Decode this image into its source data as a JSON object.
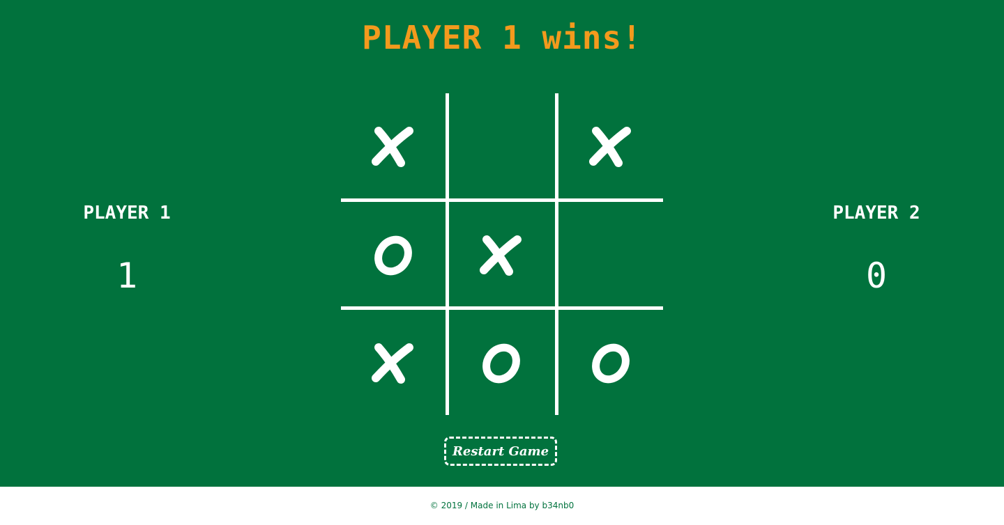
{
  "status": "PLAYER 1 wins!",
  "player1": {
    "name": "PLAYER 1",
    "score": "1"
  },
  "player2": {
    "name": "PLAYER 2",
    "score": "0"
  },
  "board": [
    "X",
    "",
    "X",
    "O",
    "X",
    "",
    "X",
    "O",
    "O"
  ],
  "restart_label": "Restart Game",
  "footer": "© 2019 / Made in Lima by b34nb0",
  "colors": {
    "background": "#01723d",
    "status": "#f39a1d",
    "marks": "#ffffff",
    "footer_text": "#01723d"
  }
}
